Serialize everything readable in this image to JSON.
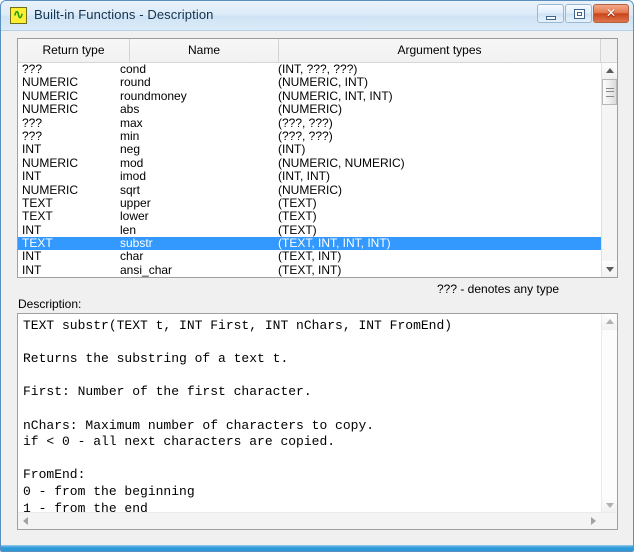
{
  "window": {
    "title": "Built-in Functions - Description",
    "icon": "snake-icon",
    "minimize_label": "",
    "maximize_label": "",
    "close_label": "✕"
  },
  "list": {
    "columns": [
      "Return type",
      "Name",
      "Argument types"
    ],
    "rows": [
      {
        "return": "???",
        "name": "cond",
        "args": "(INT, ???, ???)",
        "selected": false
      },
      {
        "return": "NUMERIC",
        "name": "round",
        "args": "(NUMERIC, INT)",
        "selected": false
      },
      {
        "return": "NUMERIC",
        "name": "roundmoney",
        "args": "(NUMERIC, INT, INT)",
        "selected": false
      },
      {
        "return": "NUMERIC",
        "name": "abs",
        "args": "(NUMERIC)",
        "selected": false
      },
      {
        "return": "???",
        "name": "max",
        "args": "(???, ???)",
        "selected": false
      },
      {
        "return": "???",
        "name": "min",
        "args": "(???, ???)",
        "selected": false
      },
      {
        "return": "INT",
        "name": "neg",
        "args": "(INT)",
        "selected": false
      },
      {
        "return": "NUMERIC",
        "name": "mod",
        "args": "(NUMERIC, NUMERIC)",
        "selected": false
      },
      {
        "return": "INT",
        "name": "imod",
        "args": "(INT, INT)",
        "selected": false
      },
      {
        "return": "NUMERIC",
        "name": "sqrt",
        "args": "(NUMERIC)",
        "selected": false
      },
      {
        "return": "TEXT",
        "name": "upper",
        "args": "(TEXT)",
        "selected": false
      },
      {
        "return": "TEXT",
        "name": "lower",
        "args": "(TEXT)",
        "selected": false
      },
      {
        "return": "INT",
        "name": "len",
        "args": "(TEXT)",
        "selected": false
      },
      {
        "return": "TEXT",
        "name": "substr",
        "args": "(TEXT, INT, INT, INT)",
        "selected": true
      },
      {
        "return": "INT",
        "name": "char",
        "args": "(TEXT, INT)",
        "selected": false
      },
      {
        "return": "INT",
        "name": "ansi_char",
        "args": "(TEXT, INT)",
        "selected": false
      }
    ]
  },
  "legend": {
    "any_type_note": "??? - denotes any type"
  },
  "description": {
    "label": "Description:",
    "text": "TEXT substr(TEXT t, INT First, INT nChars, INT FromEnd)\n\nReturns the substring of a text t.\n\nFirst: Number of the first character.\n\nnChars: Maximum number of characters to copy.\nif < 0 - all next characters are copied.\n\nFromEnd:\n0 - from the beginning\n1 - from the end"
  },
  "colors": {
    "selection": "#3399ff",
    "title_text": "#11334f",
    "close_button": "#c9441c"
  }
}
